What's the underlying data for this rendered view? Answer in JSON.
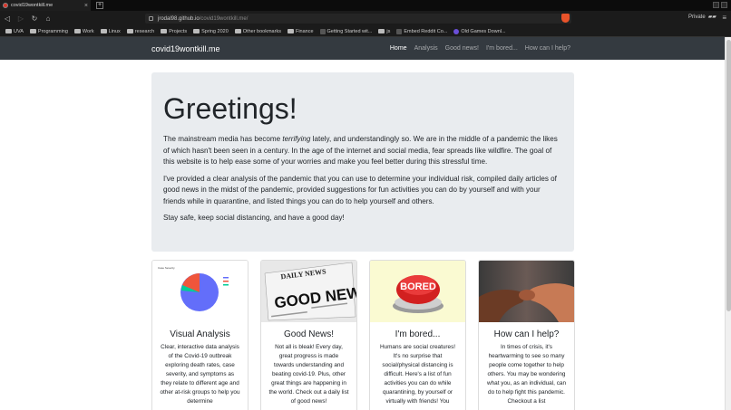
{
  "browser": {
    "tab_title": "covid19wontkill.me",
    "url_host": "jrodal98.github.io",
    "url_path": "/covid19wontkill.me/",
    "private_label": "Private",
    "bookmarks": [
      "UVA",
      "Programming",
      "Work",
      "Linux",
      "research",
      "Projects",
      "Spring 2020",
      "Other bookmarks",
      "Finance",
      "Getting Started wit...",
      "js",
      "Embed Reddit Co...",
      "Old Games Downl..."
    ]
  },
  "site": {
    "brand": "covid19wontkill.me",
    "nav": [
      "Home",
      "Analysis",
      "Good news!",
      "I'm bored...",
      "How can I help?"
    ]
  },
  "jumbotron": {
    "heading": "Greetings!",
    "p1_a": "The mainstream media has become ",
    "p1_em": "terrifying",
    "p1_b": " lately, and understandingly so. We are in the middle of a pandemic the likes of which hasn't been seen in a century. In the age of the internet and social media, fear spreads like wildfire. The goal of this website is to help ease some of your worries and make you feel better during this stressful time.",
    "p2": "I've provided a clear analysis of the pandemic that you can use to determine your individual risk, compiled daily articles of good news in the midst of the pandemic, provided suggestions for fun activities you can do by yourself and with your friends while in quarantine, and listed things you can do to help yourself and others.",
    "p3": "Stay safe, keep social distancing, and have a good day!"
  },
  "cards": [
    {
      "title": "Visual Analysis",
      "text": "Clear, interactive data analysis of the Covid-19 outbreak exploring death rates, case severity, and symptoms as they relate to different age and other at-risk groups to help you determine",
      "image_text": "Case Severity"
    },
    {
      "title": "Good News!",
      "text": "Not all is bleak! Every day, great progress is made towards understanding and beating covid-19. Plus, other great things are happening in the world. Check out a daily list of good news!",
      "image_text_top": "DAILY NEWS",
      "image_text_main": "GOOD NEWS!!"
    },
    {
      "title": "I'm bored...",
      "text": "Humans are social creatures! It's no surprise that social/physical distancing is difficult. Here's a list of fun activities you can do while quarantining, by yourself or virtually with friends! You",
      "image_text": "BORED"
    },
    {
      "title": "How can I help?",
      "text": "In times of crisis, it's heartwarming to see so many people come together to help others. You may be wondering what you, as an individual, can do to help fight this pandemic. Checkout a list"
    }
  ]
}
